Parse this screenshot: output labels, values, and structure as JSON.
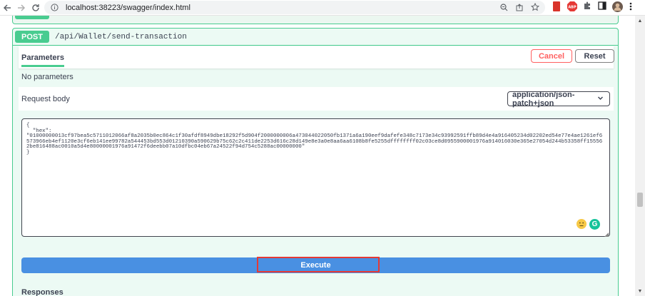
{
  "browser": {
    "url": "localhost:38223/swagger/index.html"
  },
  "operation": {
    "method": "POST",
    "path": "/api/Wallet/send-transaction"
  },
  "parameters": {
    "tab_label": "Parameters",
    "cancel_label": "Cancel",
    "reset_label": "Reset",
    "no_params_text": "No parameters"
  },
  "request_body": {
    "title": "Request body",
    "content_type": "application/json-patch+json",
    "text": "{\n  \"hex\":\n\"01000000013cf97bea5c5711012066af8a2035b0ec864c1f30afdf8949dbe18292f5d904f2000000006a473044022050fb1371a6a190eef9dafefe348c7173e34c93992591ffb89d4e4a916405234d02202ed54e77e4ae1261ef6573966eb4ef1120e3cf6eb141ee99782a544453bd553d01210390a590629b75c62c2c411de2253d616c28d149e8e3a0e8aa6aa6108b8fe5255dffffffff02c03ce8d0955900001976a914016030e365e27054d244b53358ff155562be816488ac0010a5d4e80000001976a91472f6deebb07a10dfbc04eb67a24522f94d754c5288ac00000000\"\n}"
  },
  "execute": {
    "label": "Execute"
  },
  "responses": {
    "title": "Responses"
  },
  "colors": {
    "post_green": "#49cc90",
    "execute_blue": "#4990e2",
    "cancel_red": "#ff6060",
    "highlight_red": "#e53935"
  }
}
